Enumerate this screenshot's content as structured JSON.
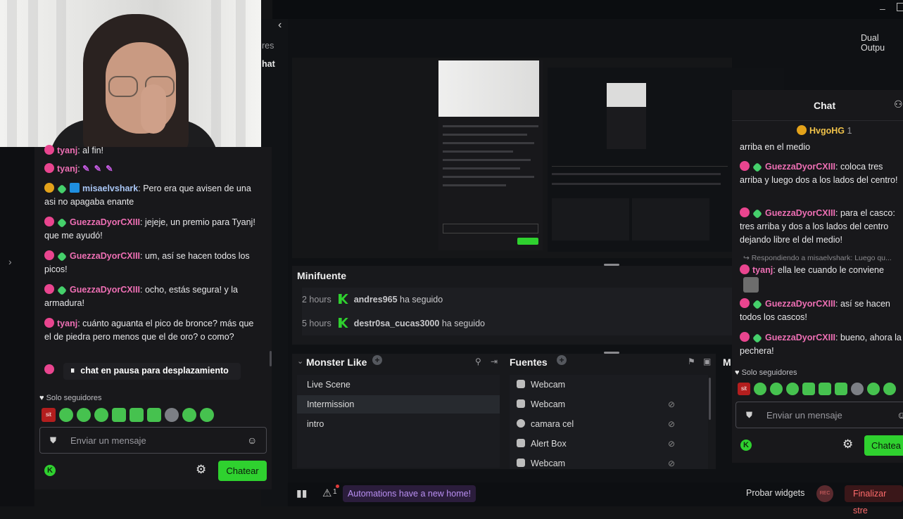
{
  "left_chat": {
    "messages": [
      {
        "user": "tyanj",
        "text": "al fin!"
      },
      {
        "user": "tyanj",
        "text": ""
      },
      {
        "user": "misaelvshark",
        "text": "Pero era que avisen de una asi no apagaba enante"
      },
      {
        "user": "GuezzaDyorCXIII",
        "text": "jejeje, un premio para Tyanj! que me ayudó!"
      },
      {
        "user": "GuezzaDyorCXIII",
        "text": "um, así se hacen todos los picos!"
      },
      {
        "user": "GuezzaDyorCXIII",
        "text": "ocho, estás segura! y la armadura!"
      },
      {
        "user": "tyanj",
        "text": "cuánto aguanta el pico de bronce? más que el de piedra pero menos que el de oro? o como?"
      }
    ],
    "paused_label": "chat en pausa para desplazamiento",
    "followers_only": "Solo seguidores",
    "input_placeholder": "Enviar un mensaje",
    "chat_button": "Chatear",
    "emote_badge": "sit"
  },
  "app": {
    "title_right": "Dual Outpu",
    "partial_left_1": "res",
    "partial_left_2": "hat"
  },
  "minifuente": {
    "title": "Minifuente",
    "rows": [
      {
        "time": "2 hours",
        "user": "andres965",
        "action": "ha seguido"
      },
      {
        "time": "5 hours",
        "user": "destr0sa_cucas3000",
        "action": "ha seguido"
      }
    ]
  },
  "scenes": {
    "title": "Monster Like",
    "items": [
      "Live Scene",
      "Intermission",
      "intro"
    ],
    "selected_index": 1
  },
  "sources": {
    "title": "Fuentes",
    "items": [
      "Webcam",
      "Webcam",
      "camara cel",
      "Alert Box",
      "Webcam"
    ]
  },
  "mixer_partial": "M",
  "right_chat": {
    "title": "Chat",
    "pinned_user": "HvgoHG",
    "pinned_count": "1",
    "messages": [
      {
        "user": "",
        "text": "arriba en el medio"
      },
      {
        "user": "GuezzaDyorCXIII",
        "text": "coloca tres arriba y luego dos a los lados del centro!"
      },
      {
        "user": "GuezzaDyorCXIII",
        "text": "para el casco: tres arriba y dos a los lados del centro dejando libre el del medio!"
      },
      {
        "user": "tyanj",
        "text": "ella lee cuando le conviene"
      },
      {
        "user": "GuezzaDyorCXIII",
        "text": "así se hacen todos los cascos!"
      },
      {
        "user": "GuezzaDyorCXIII",
        "text": "bueno, ahora la pechera!"
      }
    ],
    "reply_note": "Respondiendo a misaelvshark: Luego qu...",
    "followers_only": "Solo seguidores",
    "input_placeholder": "Enviar un mensaje",
    "chat_button": "Chatea",
    "emote_badge": "sit"
  },
  "bottom": {
    "automations": "Automations have a new home!",
    "alerts_count": "1",
    "probar": "Probar widgets",
    "rec": "REC",
    "finalizar": "Finalizar stre"
  },
  "colors": {
    "accent_green": "#2fd12f",
    "pink": "#ee6fb4",
    "purple": "#b98ff2"
  }
}
